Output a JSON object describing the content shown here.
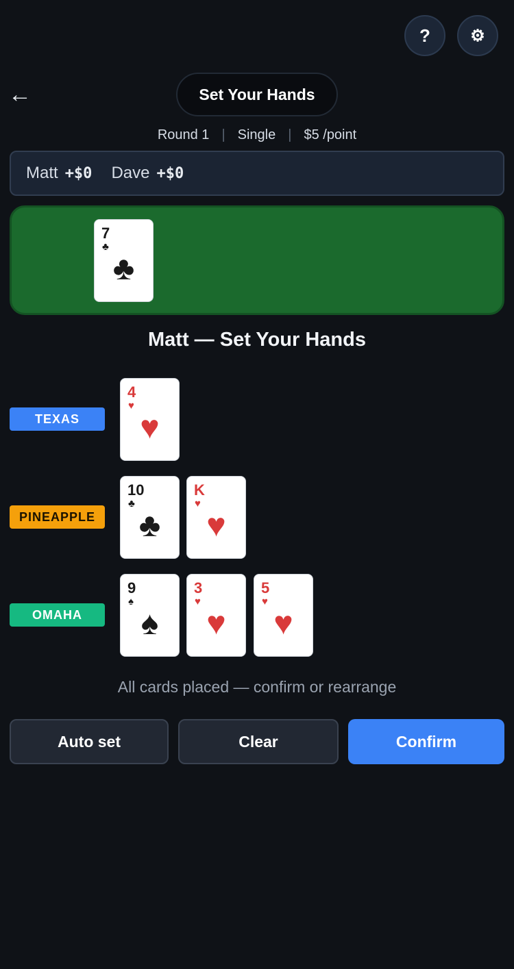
{
  "header": {
    "help_label": "?",
    "settings_label": "⚙",
    "back_label": "←",
    "title": "Set Your Hands"
  },
  "meta": {
    "round": "Round 1",
    "mode": "Single",
    "stake": "$5 /point"
  },
  "scores": [
    {
      "name": "Matt",
      "amount": "+$0"
    },
    {
      "name": "Dave",
      "amount": "+$0"
    }
  ],
  "table_cards": [
    {
      "rank": "7",
      "suit": "♣",
      "color": "black"
    }
  ],
  "player_heading": "Matt — Set Your Hands",
  "hands": {
    "texas": {
      "label": "TEXAS",
      "color": "#3b82f6",
      "cards": [
        {
          "rank": "4",
          "suit": "♥",
          "color": "red"
        }
      ]
    },
    "pineapple": {
      "label": "PINEAPPLE",
      "color": "#f5a00b",
      "cards": [
        {
          "rank": "10",
          "suit": "♣",
          "color": "black"
        },
        {
          "rank": "K",
          "suit": "♥",
          "color": "red"
        }
      ]
    },
    "omaha": {
      "label": "OMAHA",
      "color": "#16b981",
      "cards": [
        {
          "rank": "9",
          "suit": "♠",
          "color": "black"
        },
        {
          "rank": "3",
          "suit": "♥",
          "color": "red"
        },
        {
          "rank": "5",
          "suit": "♥",
          "color": "red"
        }
      ]
    }
  },
  "status_message": "All cards placed — confirm or rearrange",
  "actions": {
    "auto_set": "Auto set",
    "clear": "Clear",
    "confirm": "Confirm"
  }
}
